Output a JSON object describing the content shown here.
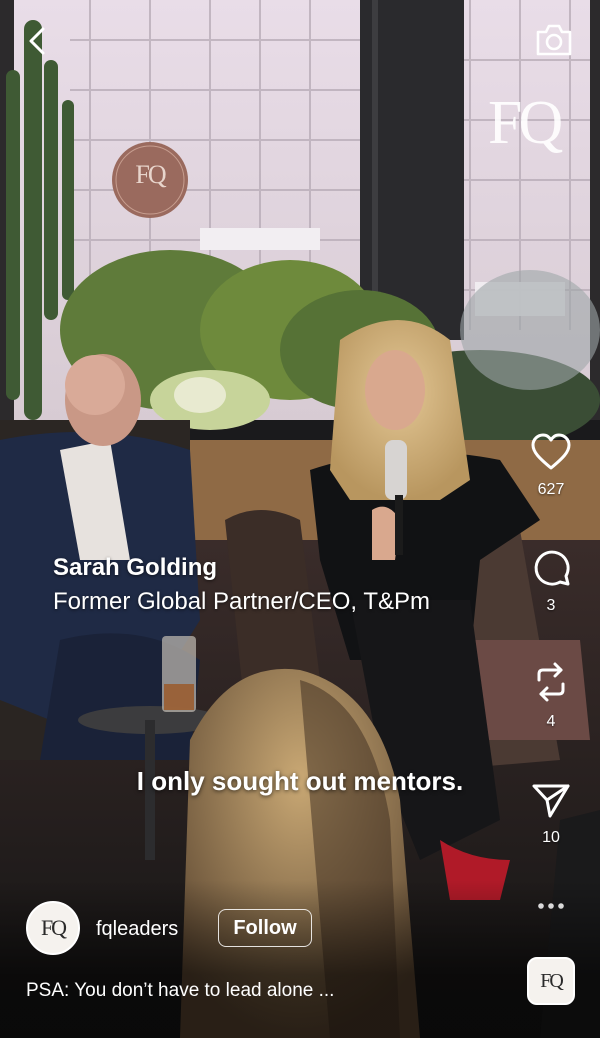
{
  "video": {
    "watermark": "FQ",
    "wall_sign": "FQ",
    "speaker_name": "Sarah Golding",
    "speaker_title": "Former Global Partner/CEO, T&Pm",
    "subtitle": "I only sought out mentors."
  },
  "top_bar": {
    "back_icon": "chevron-left-icon",
    "camera_icon": "camera-icon"
  },
  "actions": {
    "like": {
      "icon": "heart-icon",
      "count": "627"
    },
    "comment": {
      "icon": "comment-icon",
      "count": "3"
    },
    "repost": {
      "icon": "repost-icon",
      "count": "4"
    },
    "share": {
      "icon": "send-icon",
      "count": "10"
    },
    "more": {
      "icon": "more-icon"
    }
  },
  "account": {
    "avatar_text": "FQ",
    "username": "fqleaders",
    "follow_label": "Follow"
  },
  "description": "PSA: You don’t have to lead alone ...",
  "audio": {
    "thumbnail_text": "FQ"
  },
  "colors": {
    "text": "#ffffff",
    "background": "#1a1a1c",
    "brand_tile": "#f5f2ee"
  }
}
